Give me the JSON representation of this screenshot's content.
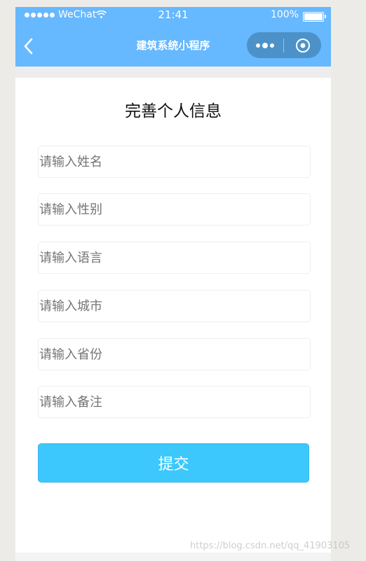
{
  "status_bar": {
    "carrier": "WeChat",
    "time": "21:41",
    "battery": "100%"
  },
  "nav": {
    "title": "建筑系统小程序",
    "icons": {
      "back": "chevron-left-icon",
      "more": "more-dots-icon",
      "close": "target-close-icon"
    }
  },
  "page": {
    "title": "完善个人信息"
  },
  "form": {
    "fields": [
      {
        "placeholder": "请输入姓名"
      },
      {
        "placeholder": "请输入性别"
      },
      {
        "placeholder": "请输入语言"
      },
      {
        "placeholder": "请输入城市"
      },
      {
        "placeholder": "请输入省份"
      },
      {
        "placeholder": "请输入备注"
      }
    ],
    "submit_label": "提交"
  },
  "watermark": "https://blog.csdn.net/qq_41903105",
  "colors": {
    "nav_bg": "#66b8ff",
    "button_bg": "#3cc8fd",
    "page_bg": "#ffffff",
    "outer_bg": "#ecebe8"
  }
}
